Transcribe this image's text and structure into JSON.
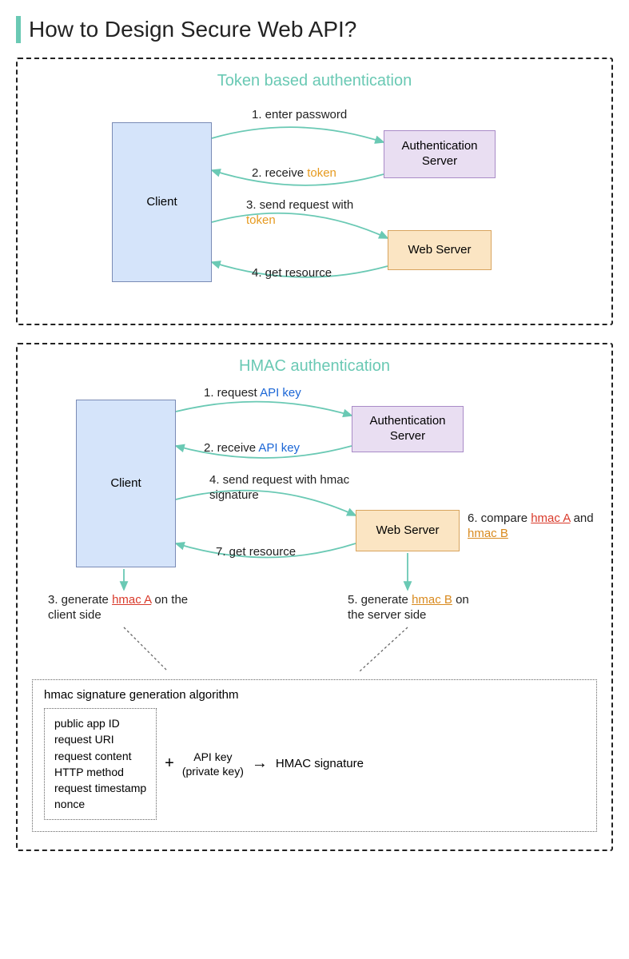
{
  "title": "How to Design Secure Web API?",
  "panel1": {
    "title": "Token based authentication",
    "client": "Client",
    "auth": "Authentication Server",
    "web": "Web Server",
    "s1": "1. enter password",
    "s2a": "2. receive ",
    "s2b": "token",
    "s3a": "3.  send request with ",
    "s3b": "token",
    "s4": "4. get resource"
  },
  "panel2": {
    "title": "HMAC authentication",
    "client": "Client",
    "auth": "Authentication Server",
    "web": "Web Server",
    "s1a": "1. request ",
    "s1b": "API key",
    "s2a": "2. receive ",
    "s2b": "API key",
    "s3a": "3. generate ",
    "s3b": "hmac A",
    "s3c": " on the client side",
    "s4": "4. send request with hmac signature",
    "s5a": "5. generate ",
    "s5b": "hmac B",
    "s5c": " on the server side",
    "s6a": "6. compare ",
    "s6b": "hmac A",
    "s6c": " and ",
    "s6d": "hmac B",
    "s7": "7. get resource",
    "algo": {
      "title": "hmac signature generation algorithm",
      "in1": "public app ID",
      "in2": "request URI",
      "in3": "request content",
      "in4": "HTTP method",
      "in5": "request timestamp",
      "in6": "nonce",
      "plus": "+",
      "key1": "API key",
      "key2": "(private key)",
      "arrow": "→",
      "out": "HMAC signature"
    }
  }
}
